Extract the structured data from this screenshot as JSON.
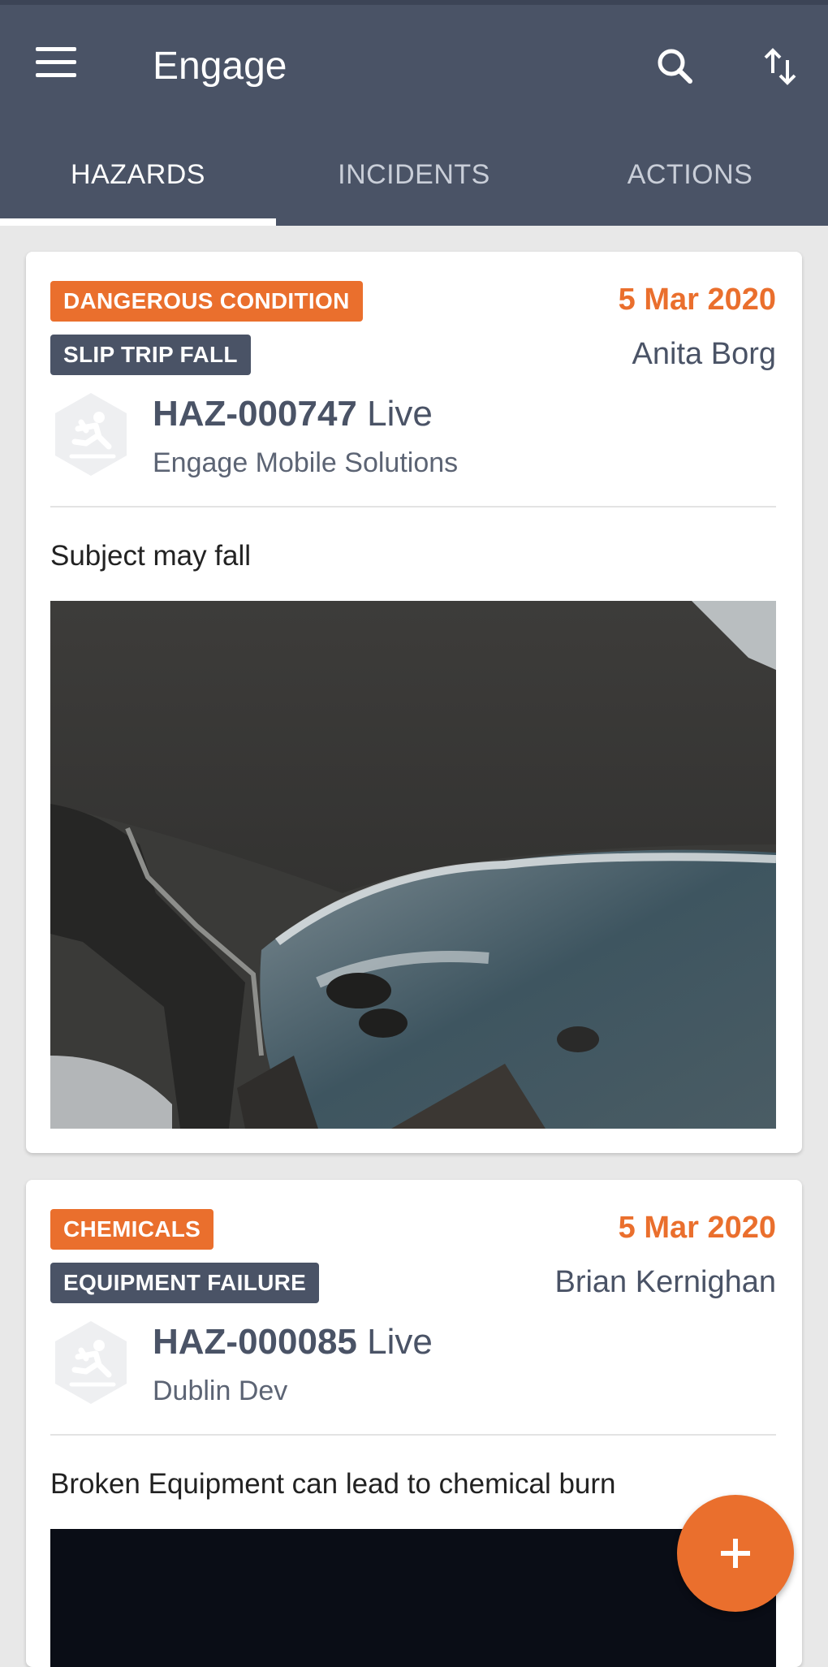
{
  "header": {
    "title": "Engage",
    "menu_icon": "hamburger-menu-icon",
    "search_icon": "search-icon",
    "sort_icon": "sort-arrows-icon",
    "background_color": "#4a5366"
  },
  "tabs": [
    {
      "label": "HAZARDS",
      "active": true
    },
    {
      "label": "INCIDENTS",
      "active": false
    },
    {
      "label": "ACTIONS",
      "active": false
    }
  ],
  "accent_color": "#ea6f2d",
  "hazards": [
    {
      "category": "DANGEROUS CONDITION",
      "type": "SLIP TRIP FALL",
      "date": "5 Mar 2020",
      "owner": "Anita Borg",
      "id": "HAZ-000747",
      "status": "Live",
      "organization": "Engage Mobile Solutions",
      "description": "Subject may fall",
      "icon": "slip-fall-hex-icon",
      "image": "coastal-cliff-photo"
    },
    {
      "category": "CHEMICALS",
      "type": "EQUIPMENT FAILURE",
      "date": "5 Mar 2020",
      "owner": "Brian Kernighan",
      "id": "HAZ-000085",
      "status": "Live",
      "organization": "Dublin Dev",
      "description": "Broken Equipment can lead to chemical burn",
      "icon": "slip-fall-hex-icon",
      "image": "dark-photo"
    }
  ],
  "fab": {
    "icon": "plus-icon"
  }
}
